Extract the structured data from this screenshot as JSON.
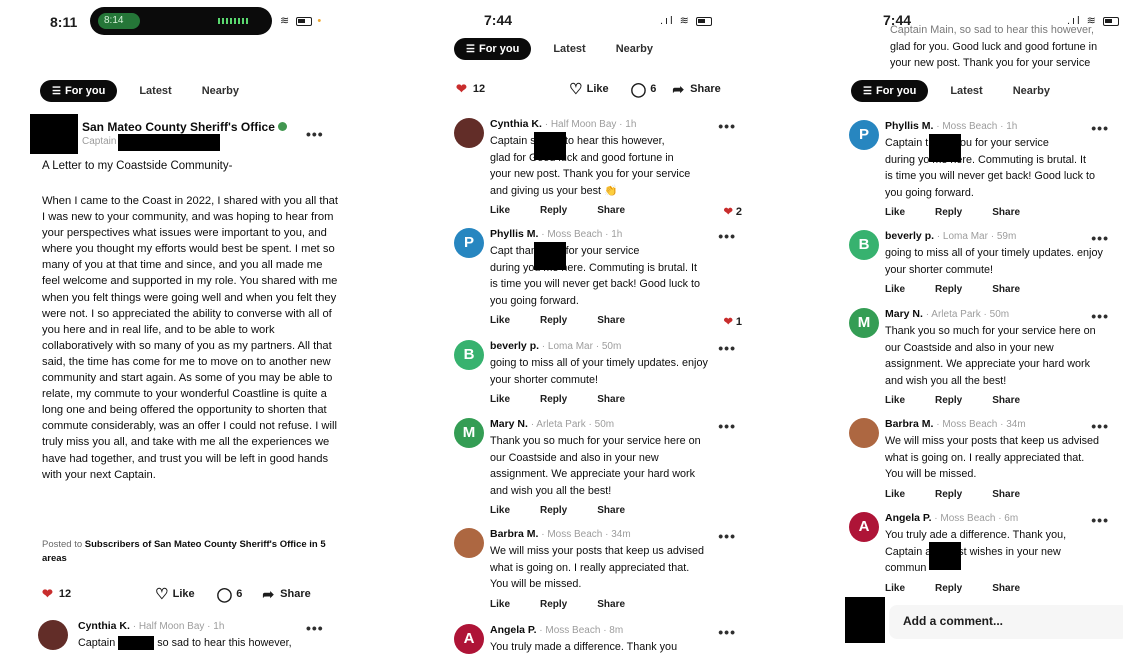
{
  "screen1": {
    "time": "8:11",
    "island_time": "8:14",
    "tabs": [
      "For you",
      "Latest",
      "Nearby"
    ],
    "post": {
      "org": "San Mateo County Sheriff's Office",
      "role": "Captain",
      "title": "A Letter to my Coastside Community-",
      "body": "When I came to the Coast in 2022, I shared with you all that I was new to your community, and was hoping to hear from your perspectives what issues were important to you, and where you thought my efforts would best be spent. I met so many of you at that time and since, and you all made me feel welcome and supported in my role. You shared with me when you felt things were going well and when you felt they were not. I so appreciated the ability to converse with all of you here and in real life, and to be able to work collaboratively with so many of you as my partners. All that said, the time has come for me to move on to another new community and start again. As some of you may be able to relate, my commute to your wonderful Coastline is quite a long one and being offered the opportunity to shorten that commute considerably, was an offer I could not refuse. I will truly miss you all, and take with me all the experiences we have had together, and trust you will be left in good hands with your next Captain.",
      "posted_prefix": "Posted to",
      "posted_target": "Subscribers of San Mateo County Sheriff's Office in 5 areas",
      "reactions": "12",
      "like": "Like",
      "comments": "6",
      "share": "Share"
    },
    "first_comment": {
      "name": "Cynthia K.",
      "meta": "Half Moon Bay · 1h",
      "text_a": "Captain",
      "text_b": "so sad to hear this however,"
    }
  },
  "screen2": {
    "time": "7:44",
    "tabs": [
      "For you",
      "Latest",
      "Nearby"
    ],
    "reactions": "12",
    "like": "Like",
    "comments": "6",
    "share": "Share",
    "comments_list": [
      {
        "initial": "",
        "name": "Cynthia K.",
        "meta": "Half Moon Bay · 1h",
        "lines": [
          "Captain        so sad to hear this however,",
          "glad for       Good luck and good fortune in",
          "your new post. Thank you for your service",
          "and giving us your best 👏"
        ],
        "likes": "2"
      },
      {
        "initial": "P",
        "name": "Phyllis M.",
        "meta": "Moss Beach · 1h",
        "lines": [
          "Capt              thank you for your service",
          "during you      me here. Commuting is brutal. It",
          "is time you will never get back! Good luck to",
          "you going forward."
        ],
        "likes": "1"
      },
      {
        "initial": "B",
        "name": "beverly p.",
        "meta": "Loma Mar · 50m",
        "lines": [
          "going to miss all of your timely updates. enjoy",
          "your shorter commute!"
        ],
        "likes": ""
      },
      {
        "initial": "M",
        "name": "Mary N.",
        "meta": "Arleta Park · 50m",
        "lines": [
          "Thank you so much for your service here on",
          "our Coastside and also in your new",
          "assignment.  We appreciate your hard work",
          "and wish you all the best!"
        ],
        "likes": ""
      },
      {
        "initial": "",
        "name": "Barbra M.",
        "meta": "Moss Beach · 34m",
        "lines": [
          "We will miss your posts that keep us advised",
          "what is going on. I really appreciated that.",
          "You will be missed."
        ],
        "likes": ""
      },
      {
        "initial": "A",
        "name": "Angela P.",
        "meta": "Moss Beach · 8m",
        "lines": [
          "You truly made a difference. Thank you"
        ],
        "likes": ""
      }
    ],
    "actions": {
      "like": "Like",
      "reply": "Reply",
      "share": "Share"
    }
  },
  "screen3": {
    "time": "7:44",
    "tabs": [
      "For you",
      "Latest",
      "Nearby"
    ],
    "top_lines": [
      "Captain Main, so sad to hear this however,",
      "glad for you. Good luck and good fortune in",
      "your new post. Thank you for your service"
    ],
    "comments_list": [
      {
        "initial": "P",
        "name": "Phyllis M.",
        "meta": "Moss Beach · 1h",
        "lines": [
          "Captain         thank you for your service",
          "during yo      me here. Commuting is brutal. It",
          "is time you will never get back! Good luck to",
          "you going forward."
        ]
      },
      {
        "initial": "B",
        "name": "beverly p.",
        "meta": "Loma Mar · 59m",
        "lines": [
          "going to miss all of your timely updates. enjoy",
          "your shorter commute!"
        ]
      },
      {
        "initial": "M",
        "name": "Mary N.",
        "meta": "Arleta Park · 50m",
        "lines": [
          "Thank you so much for your service here on",
          "our Coastside and also in your new",
          "assignment.  We appreciate your hard work",
          "and wish you all the best!"
        ]
      },
      {
        "initial": "",
        "name": "Barbra M.",
        "meta": "Moss Beach · 34m",
        "lines": [
          "We will miss your posts that keep us advised",
          "what is going on. I really appreciated that.",
          "You will be missed."
        ]
      },
      {
        "initial": "A",
        "name": "Angela P.",
        "meta": "Moss Beach · 6m",
        "lines": [
          "You truly      ade a difference. Thank you,",
          "Captain          and best wishes in your new",
          "commun"
        ]
      }
    ],
    "actions": {
      "like": "Like",
      "reply": "Reply",
      "share": "Share"
    },
    "add_comment": "Add a comment..."
  },
  "colors": {
    "heart": "#d92b2b",
    "avatar_p": "#1e88c9",
    "avatar_b": "#2bb56a",
    "avatar_m": "#2ba04f",
    "avatar_a": "#c0133a",
    "avatar_photo_c": "#6b2f2a",
    "avatar_photo_b": "#b5663c"
  }
}
